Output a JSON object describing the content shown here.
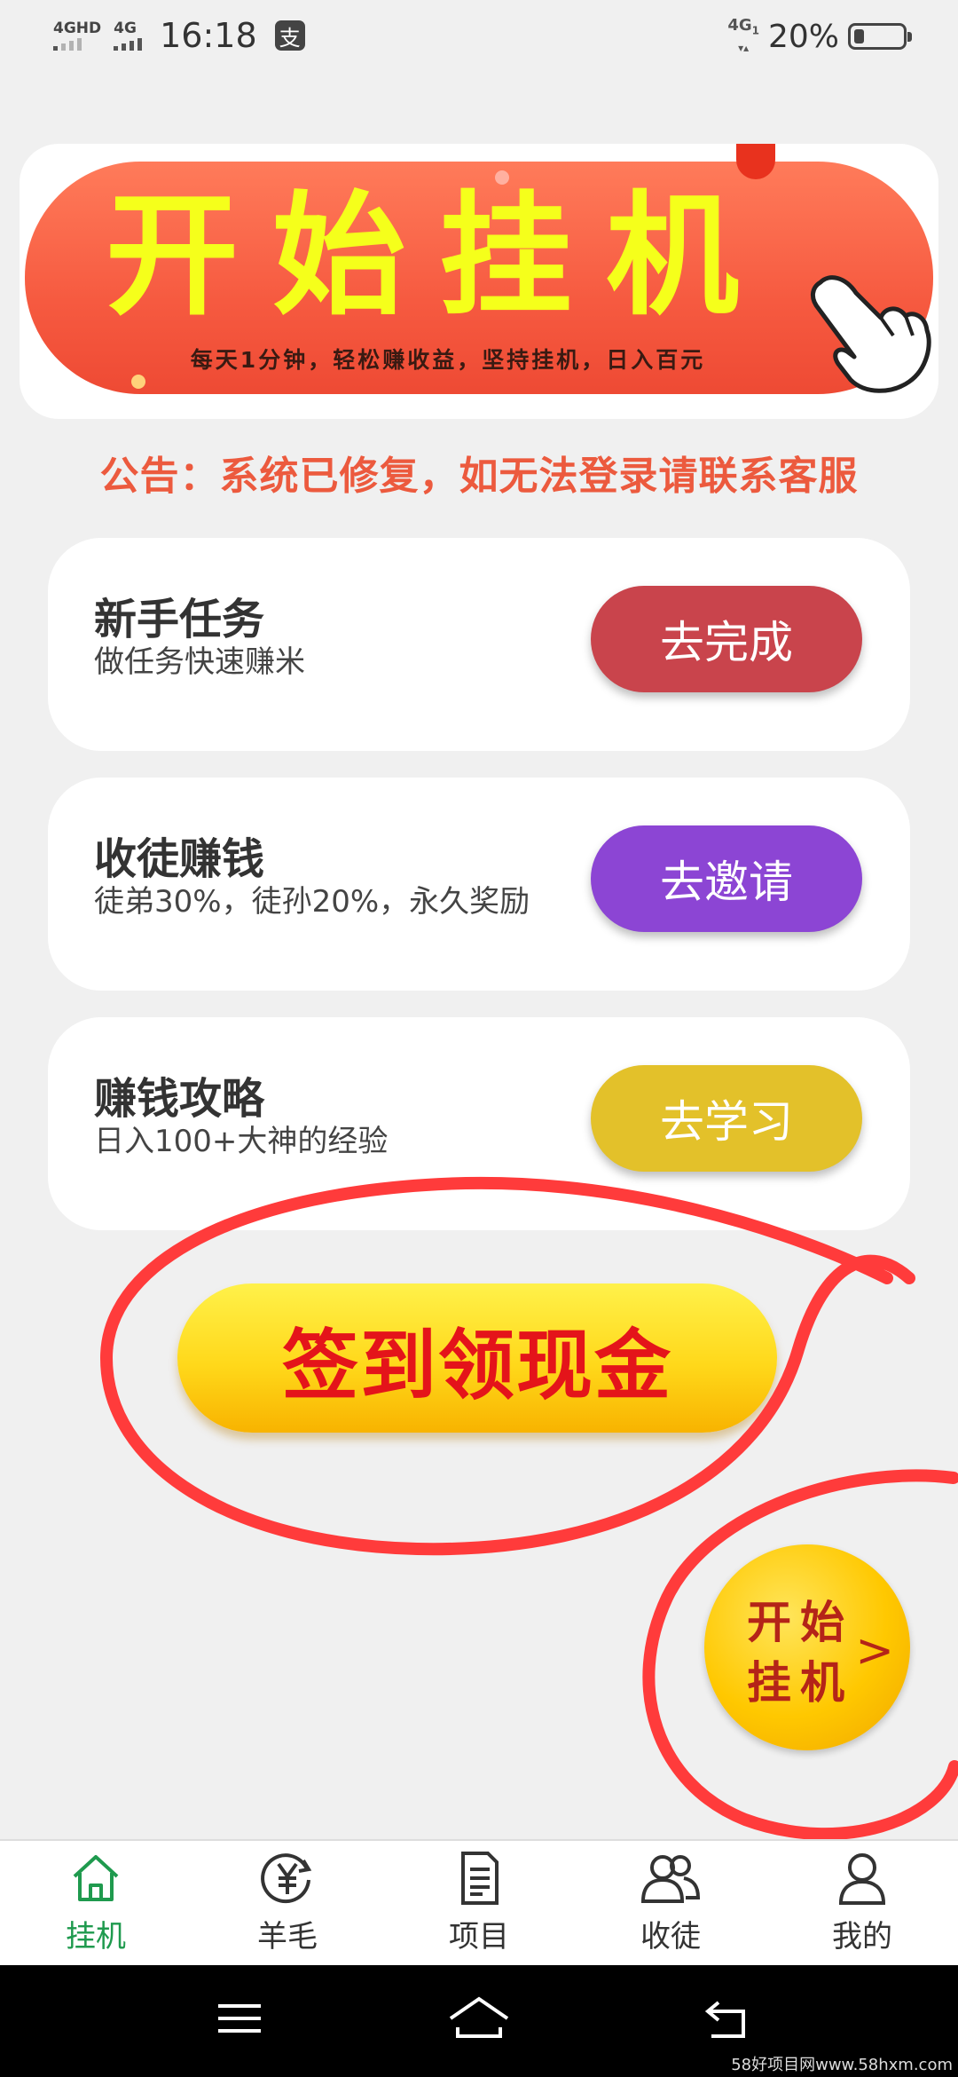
{
  "status_bar": {
    "network_left_1": "4GHD",
    "network_left_2": "4G",
    "time": "16:18",
    "app_icon": "支",
    "network_right": "4G",
    "network_right_sub": "1",
    "battery_percent": "20%",
    "battery_level": 0.2
  },
  "banner": {
    "title": "开始挂机",
    "subtitle": "每天1分钟，轻松赚收益，坚持挂机，日入百元"
  },
  "notice": "公告：系统已修复，如无法登录请联系客服",
  "tasks": [
    {
      "title": "新手任务",
      "desc": "做任务快速赚米",
      "button": "去完成",
      "color": "#c9444c"
    },
    {
      "title": "收徒赚钱",
      "desc": "徒弟30%，徒孙20%，永久奖励",
      "button": "去邀请",
      "color": "#8c45d4"
    },
    {
      "title": "赚钱攻略",
      "desc": "日入100+大神的经验",
      "button": "去学习",
      "color": "#e3c12a"
    }
  ],
  "signin_button": "签到领现金",
  "float_button": {
    "line1": "开始",
    "line2": "挂机",
    "arrow": ">"
  },
  "tabbar": [
    {
      "label": "挂机",
      "icon": "home-icon",
      "active": true
    },
    {
      "label": "羊毛",
      "icon": "yuan-icon",
      "active": false
    },
    {
      "label": "项目",
      "icon": "document-icon",
      "active": false
    },
    {
      "label": "收徒",
      "icon": "users-icon",
      "active": false
    },
    {
      "label": "我的",
      "icon": "person-icon",
      "active": false
    }
  ],
  "colors": {
    "active_tab": "#1f9a4e",
    "notice": "#ec5a3e",
    "annotation": "#ff3b3b"
  },
  "watermark": "58好项目网www.58hxm.com"
}
